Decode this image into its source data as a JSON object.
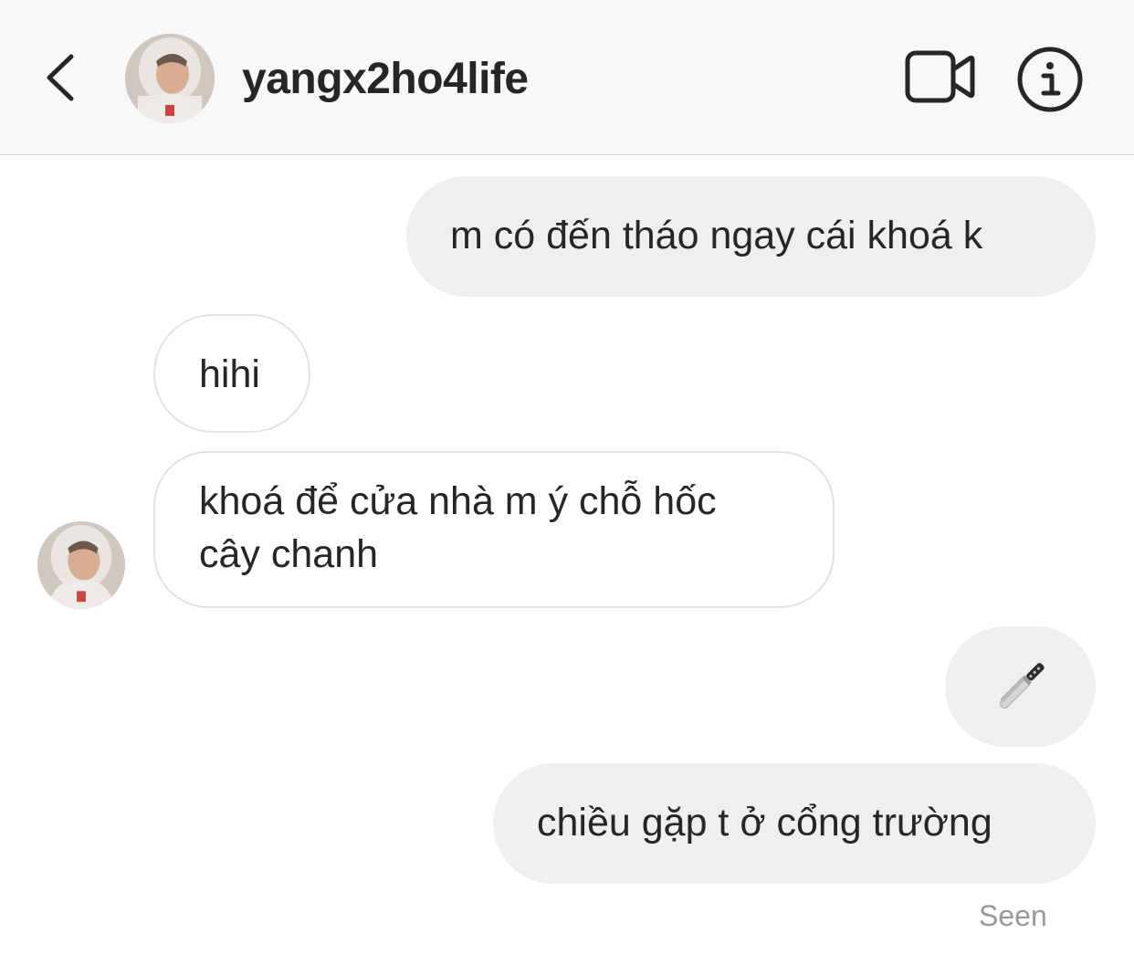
{
  "header": {
    "username": "yangx2ho4life",
    "back_icon": "chevron-left-icon",
    "video_icon": "video-camera-icon",
    "info_icon": "info-icon"
  },
  "messages": [
    {
      "direction": "outgoing",
      "text": "m có đến tháo ngay cái khoá k"
    },
    {
      "direction": "incoming",
      "text": "hihi"
    },
    {
      "direction": "incoming",
      "lines": [
        "khoá để cửa nhà m ý chỗ hốc",
        "cây chanh"
      ]
    },
    {
      "direction": "outgoing",
      "emoji": "kitchen-knife-icon"
    },
    {
      "direction": "outgoing",
      "text": "chiều gặp t ở cổng trường"
    }
  ],
  "status": {
    "seen": "Seen"
  },
  "colors": {
    "header_bg": "#f8f8f8",
    "outgoing_bubble": "#efefef",
    "incoming_border": "#e2e2e2",
    "text": "#262626",
    "muted": "#999999"
  }
}
